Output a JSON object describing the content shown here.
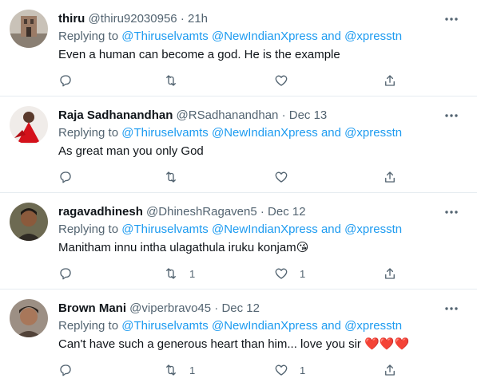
{
  "tweets": [
    {
      "name": "thiru",
      "handle": "@thiru92030956",
      "time": "21h",
      "replying_prefix": "Replying to",
      "mentions": [
        "@Thiruselvamts",
        "@NewIndianXpress",
        "and",
        "@xpresstn"
      ],
      "text": "Even a human can become a god. He is the example",
      "emoji": "",
      "retweets": "",
      "likes": "",
      "avatar": "avatar-building"
    },
    {
      "name": "Raja Sadhanandhan",
      "handle": "@RSadhanandhan",
      "time": "Dec 13",
      "replying_prefix": "Replying to",
      "mentions": [
        "@Thiruselvamts",
        "@NewIndianXpress",
        "and",
        "@xpresstn"
      ],
      "text": "As great man you only God",
      "emoji": "",
      "retweets": "",
      "likes": "",
      "avatar": "avatar-red-dress"
    },
    {
      "name": "ragavadhinesh",
      "handle": "@DhineshRagaven5",
      "time": "Dec 12",
      "replying_prefix": "Replying to",
      "mentions": [
        "@Thiruselvamts",
        "@NewIndianXpress",
        "and",
        "@xpresstn"
      ],
      "text": "Manitham innu intha ulagathula iruku konjam",
      "emoji": "😘",
      "retweets": "1",
      "likes": "1",
      "avatar": "avatar-man"
    },
    {
      "name": "Brown Mani",
      "handle": "@viperbravo45",
      "time": "Dec 12",
      "replying_prefix": "Replying to",
      "mentions": [
        "@Thiruselvamts",
        "@NewIndianXpress",
        "and",
        "@xpresstn"
      ],
      "text": "Can't have such a generous heart than him... love you sir",
      "emoji": "❤️❤️❤️",
      "retweets": "1",
      "likes": "1",
      "avatar": "avatar-man-2"
    }
  ],
  "colors": {
    "link": "#1d9bf0",
    "secondary": "#536471",
    "divider": "#e6ecf0"
  }
}
